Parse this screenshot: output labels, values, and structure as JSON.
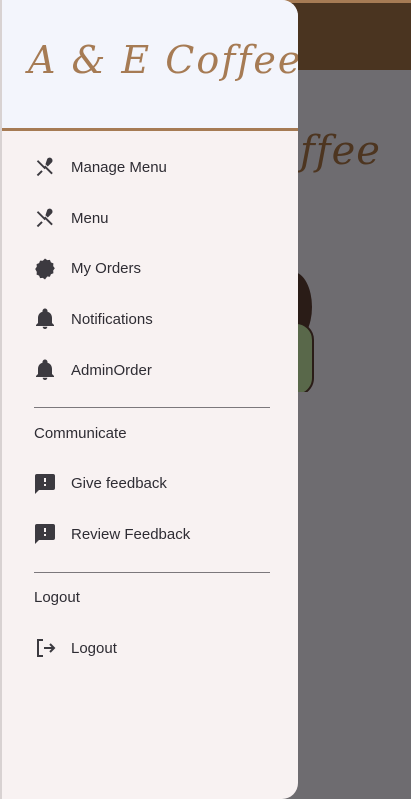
{
  "app": {
    "brand": "A & E Coffee",
    "background_title": "ffee"
  },
  "colors": {
    "accent": "#a67b54",
    "appbar": "#4a3420",
    "scrim": "#6e6c70",
    "drawer_bg": "#f8f2f2",
    "header_bg": "#f3f5fc"
  },
  "drawer": {
    "items": [
      {
        "label": "Manage Menu",
        "icon": "utensils-icon"
      },
      {
        "label": "Menu",
        "icon": "utensils-icon"
      },
      {
        "label": "My Orders",
        "icon": "badge-icon"
      },
      {
        "label": "Notifications",
        "icon": "bell-icon"
      },
      {
        "label": "AdminOrder",
        "icon": "bell-icon"
      }
    ],
    "communicate": {
      "title": "Communicate",
      "items": [
        {
          "label": "Give feedback",
          "icon": "feedback-icon"
        },
        {
          "label": "Review Feedback",
          "icon": "feedback-icon"
        }
      ]
    },
    "logout_section": {
      "title": "Logout",
      "items": [
        {
          "label": "Logout",
          "icon": "logout-icon"
        }
      ]
    }
  }
}
